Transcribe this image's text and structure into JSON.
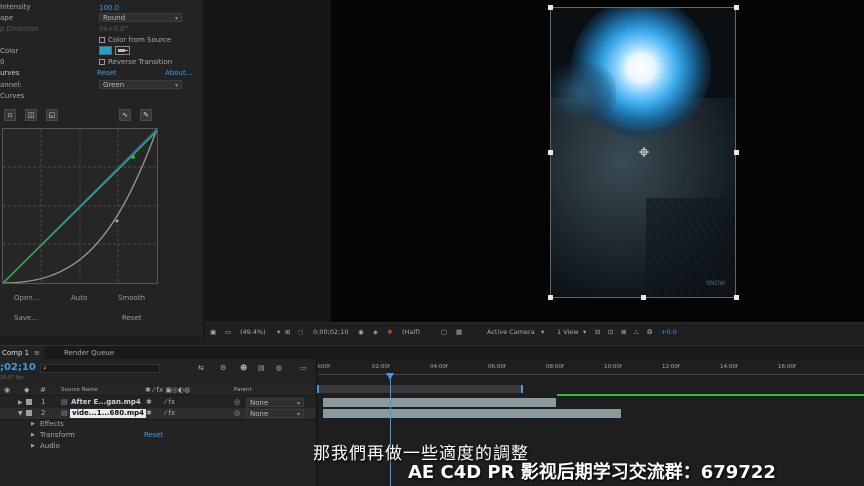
{
  "effects": {
    "intensity_label": "Intensity",
    "intensity_value": "100.0",
    "shape_label": "ape",
    "shape_value": "Round",
    "direction_label": "p Direction",
    "direction_value": "0x+0.0°",
    "color_from_source": "Color from Source",
    "color_label": "Color",
    "reverse_transition": "Reverse Transition",
    "curves_label": "urves",
    "reset": "Reset",
    "about": "About...",
    "channel_label": "annel:",
    "channel_value": "Green",
    "curves_sub": "Curves",
    "open": "Open...",
    "auto": "Auto",
    "smooth": "Smooth",
    "save": "Save...",
    "reset2": "Reset",
    "p0": "0"
  },
  "viewer": {
    "watermark": "SNOW"
  },
  "command_bar": {
    "zoom": "(49.4%)",
    "timecode": "0;00;02;10",
    "resolution": "(Half)",
    "camera": "Active Camera",
    "view": "1 View",
    "exposure": "+0.0"
  },
  "timeline": {
    "tab_comp": "Comp 1",
    "tab_render": "Render Queue",
    "current_time": ";02;10",
    "fps": "29.97 fps",
    "search_placeholder": "",
    "col_source_name": "Source Name",
    "col_parent": "Parent",
    "layers": [
      {
        "num": "1",
        "name": "After E...gan.mp4",
        "parent": "None"
      },
      {
        "num": "2",
        "name": "vide...1...680.mp4",
        "parent": "None"
      }
    ],
    "effects_label": "Effects",
    "transform_label": "Transform",
    "transform_reset": "Reset",
    "audio_label": "Audio",
    "ruler_ticks": [
      "k00f",
      "02:00f",
      "04:00f",
      "06:00f",
      "08:00f",
      "10:00f",
      "12:00f",
      "14:00f",
      "16:00f"
    ]
  },
  "subtitle": {
    "caption": "那我們再做一些適度的調整",
    "watermark": "AE C4D PR 影视后期学习交流群：679722"
  },
  "colors": {
    "accent_blue": "#3b9be8",
    "green_bar": "#27c23b",
    "clip_color": "#8a9a9c"
  }
}
